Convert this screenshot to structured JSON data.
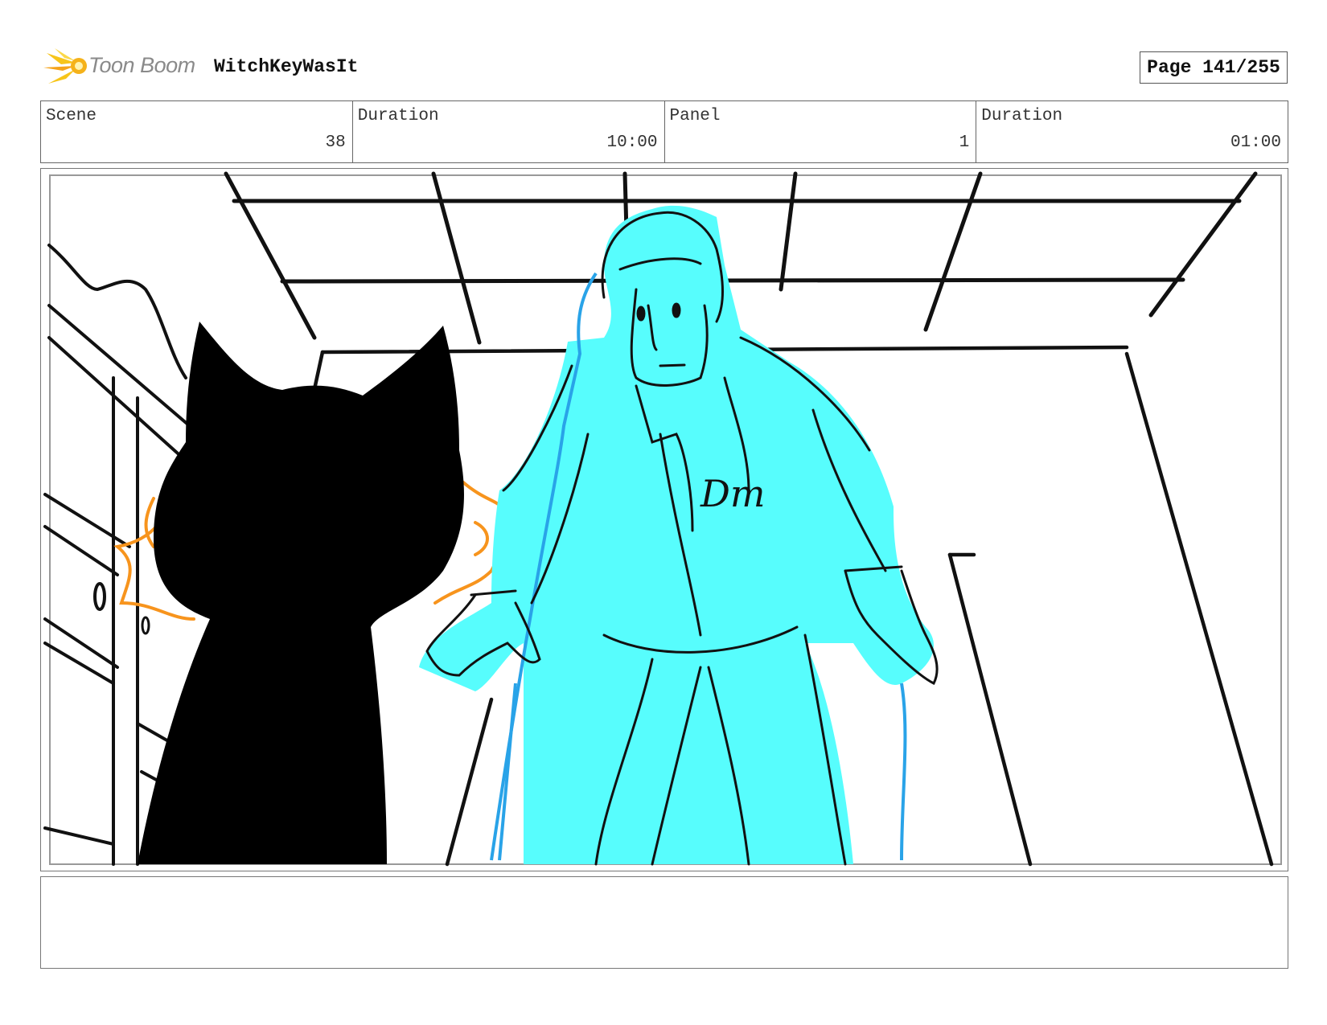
{
  "header": {
    "logo_text": "Toon Boom",
    "project_title": "WitchKeyWasIt",
    "page_label": "Page 141/255"
  },
  "info": [
    {
      "label": "Scene",
      "value": "38"
    },
    {
      "label": "Duration",
      "value": "10:00"
    },
    {
      "label": "Panel",
      "value": "1"
    },
    {
      "label": "Duration",
      "value": "01:00"
    }
  ],
  "panel": {
    "monogram": "Dm",
    "colors": {
      "cat": "#000000",
      "glow_orange": "#f7941d",
      "man_fill": "#57fdfd",
      "man_outline": "#29a3e8",
      "line": "#111111"
    }
  },
  "notes": {
    "text": ""
  }
}
